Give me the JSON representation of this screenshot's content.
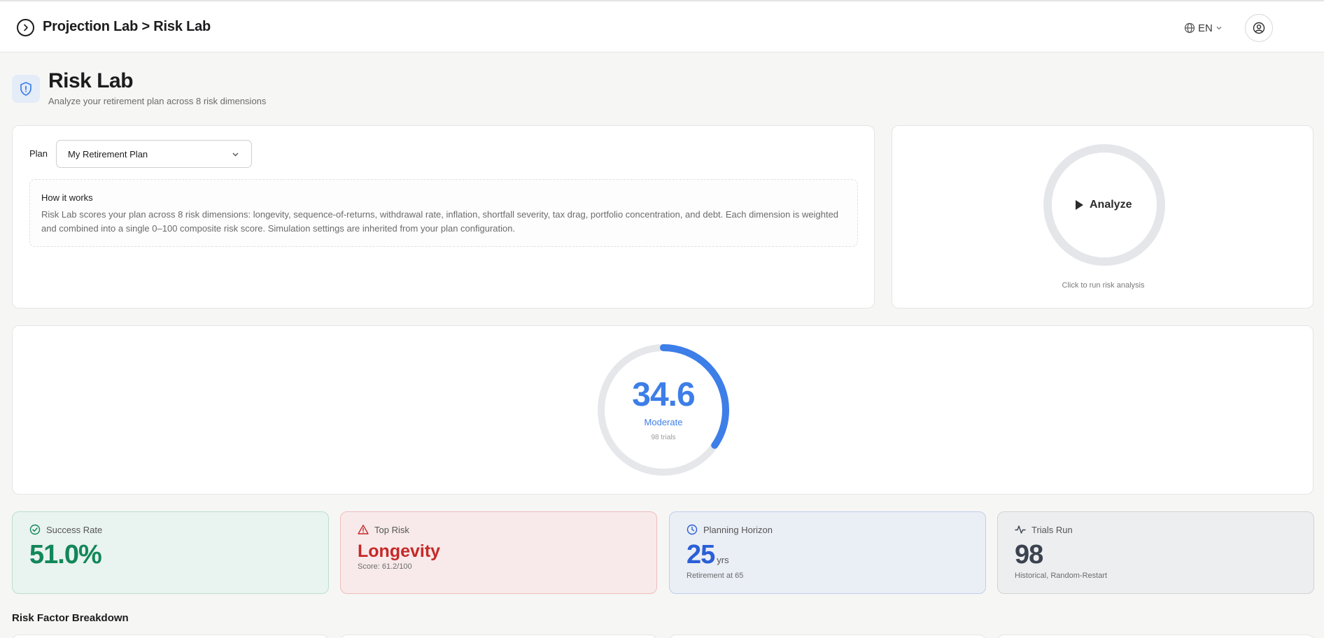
{
  "header": {
    "breadcrumb": "Projection Lab > Risk Lab",
    "language": "EN"
  },
  "page": {
    "title": "Risk Lab",
    "subtitle": "Analyze your retirement plan across 8 risk dimensions"
  },
  "plan": {
    "label": "Plan",
    "selected": "My Retirement Plan"
  },
  "how_it_works": {
    "title": "How it works",
    "text": "Risk Lab scores your plan across 8 risk dimensions: longevity, sequence-of-returns, withdrawal rate, inflation, shortfall severity, tax drag, portfolio concentration, and debt. Each dimension is weighted and combined into a single 0–100 composite risk score. Simulation settings are inherited from your plan configuration."
  },
  "analyze": {
    "button_label": "Analyze",
    "caption": "Click to run risk analysis"
  },
  "score": {
    "value": "34.6",
    "fraction": 0.346,
    "level": "Moderate",
    "trials": "98 trials",
    "accent": "#3d7ee8"
  },
  "stats": {
    "success": {
      "label": "Success Rate",
      "value": "51.0%",
      "color": "#12875a",
      "icon": "check-circle-icon"
    },
    "top_risk": {
      "label": "Top Risk",
      "value": "Longevity",
      "sub": "Score: 61.2/100",
      "color": "#c62828",
      "icon": "warning-triangle-icon"
    },
    "horizon": {
      "label": "Planning Horizon",
      "value": "25",
      "unit": "yrs",
      "sub": "Retirement at 65",
      "color": "#2a5fd6",
      "icon": "clock-icon"
    },
    "trials": {
      "label": "Trials Run",
      "value": "98",
      "sub": "Historical, Random-Restart",
      "color": "#3b4250",
      "icon": "activity-pulse-icon"
    }
  },
  "breakdown": {
    "title": "Risk Factor Breakdown"
  }
}
